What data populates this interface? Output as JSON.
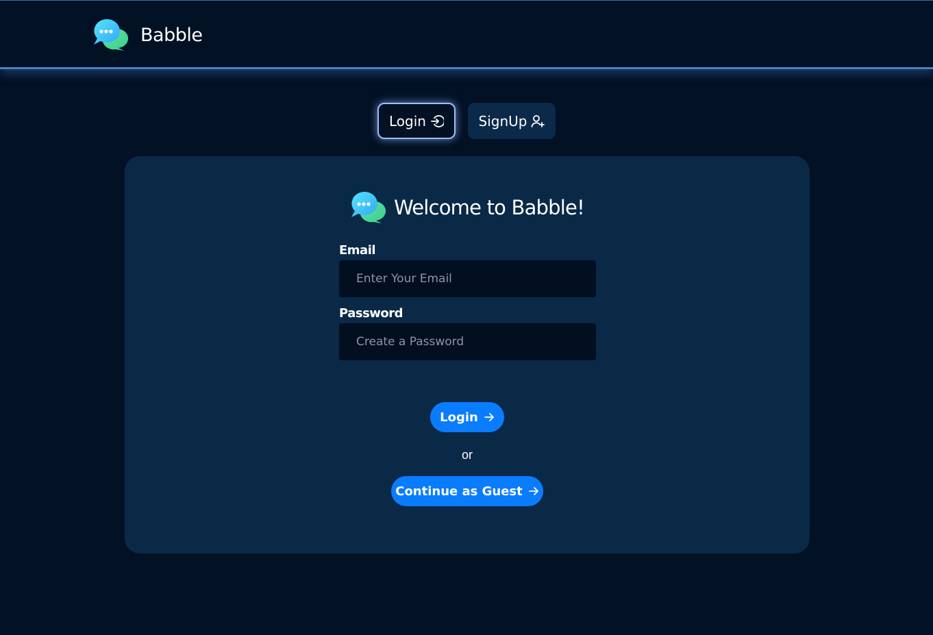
{
  "navbar": {
    "brand_name": "Babble",
    "logo_icon": "chat-bubbles-icon"
  },
  "tabs": [
    {
      "label": "Login",
      "icon": "login-icon",
      "active": true
    },
    {
      "label": "SignUp",
      "icon": "user-add-icon",
      "active": false
    }
  ],
  "card": {
    "title": "Welcome to Babble!",
    "email": {
      "label": "Email",
      "placeholder": "Enter Your Email",
      "value": ""
    },
    "password": {
      "label": "Password",
      "placeholder": "Create a Password",
      "value": ""
    },
    "login_button": "Login",
    "separator": "or",
    "guest_button": "Continue as Guest"
  },
  "colors": {
    "background": "#021124",
    "card": "#0a2947",
    "accent": "#0a7cff",
    "input_bg": "#020f20",
    "tab_glow": "#9bc0ff"
  }
}
